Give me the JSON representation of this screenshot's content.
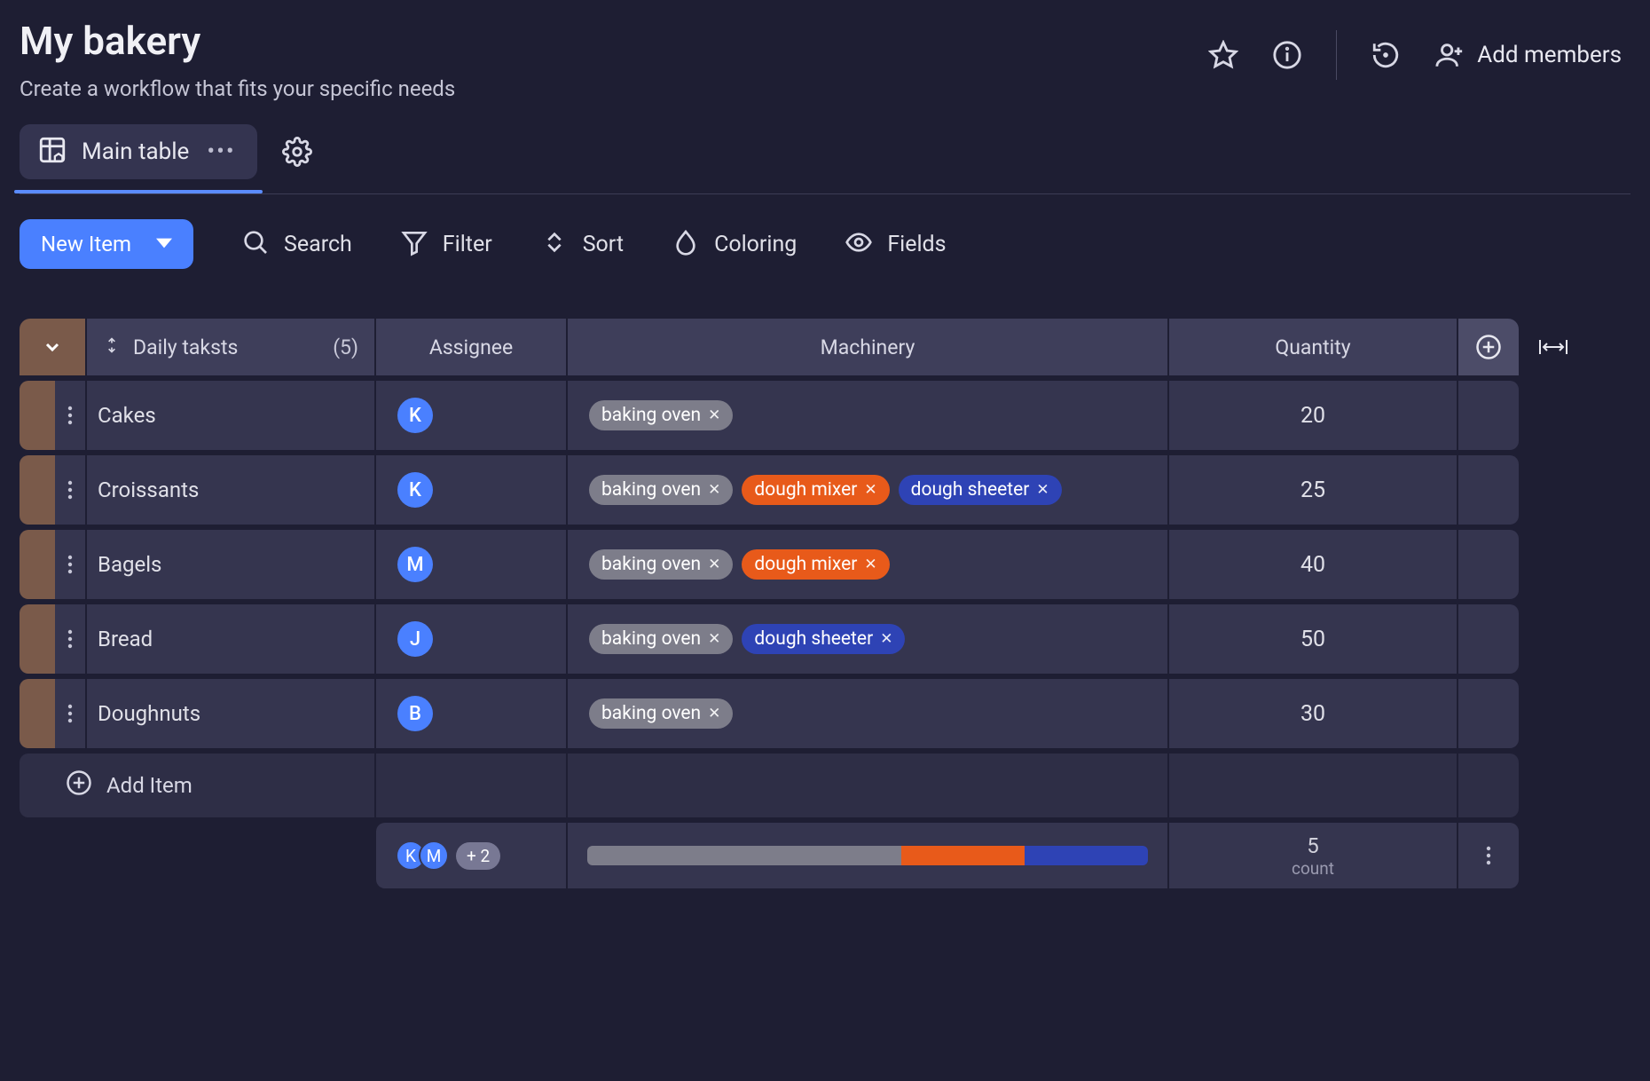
{
  "header": {
    "title": "My bakery",
    "subtitle": "Create a workflow that fits your specific needs",
    "add_members_label": "Add members"
  },
  "tabs": {
    "active_label": "Main table"
  },
  "toolbar": {
    "new_item_label": "New Item",
    "search_label": "Search",
    "filter_label": "Filter",
    "sort_label": "Sort",
    "coloring_label": "Coloring",
    "fields_label": "Fields"
  },
  "table": {
    "group_name": "Daily taksts",
    "group_count": "(5)",
    "columns": {
      "assignee": "Assignee",
      "machinery": "Machinery",
      "quantity": "Quantity"
    },
    "add_item_label": "Add Item",
    "tag_colors": {
      "baking oven": "gray",
      "dough mixer": "orange",
      "dough sheeter": "blue"
    },
    "rows": [
      {
        "name": "Cakes",
        "assignee": "K",
        "machinery": [
          "baking oven"
        ],
        "quantity": "20"
      },
      {
        "name": "Croissants",
        "assignee": "K",
        "machinery": [
          "baking oven",
          "dough mixer",
          "dough sheeter"
        ],
        "quantity": "25"
      },
      {
        "name": "Bagels",
        "assignee": "M",
        "machinery": [
          "baking oven",
          "dough mixer"
        ],
        "quantity": "40"
      },
      {
        "name": "Bread",
        "assignee": "J",
        "machinery": [
          "baking oven",
          "dough sheeter"
        ],
        "quantity": "50"
      },
      {
        "name": "Doughnuts",
        "assignee": "B",
        "machinery": [
          "baking oven"
        ],
        "quantity": "30"
      }
    ]
  },
  "footer": {
    "avatars": [
      "K",
      "M"
    ],
    "more_label": "+ 2",
    "bar_segments": [
      {
        "color": "#7d7d8a",
        "pct": 56
      },
      {
        "color": "#e85a1a",
        "pct": 22
      },
      {
        "color": "#2e43b5",
        "pct": 22
      }
    ],
    "quantity_value": "5",
    "quantity_label": "count"
  }
}
